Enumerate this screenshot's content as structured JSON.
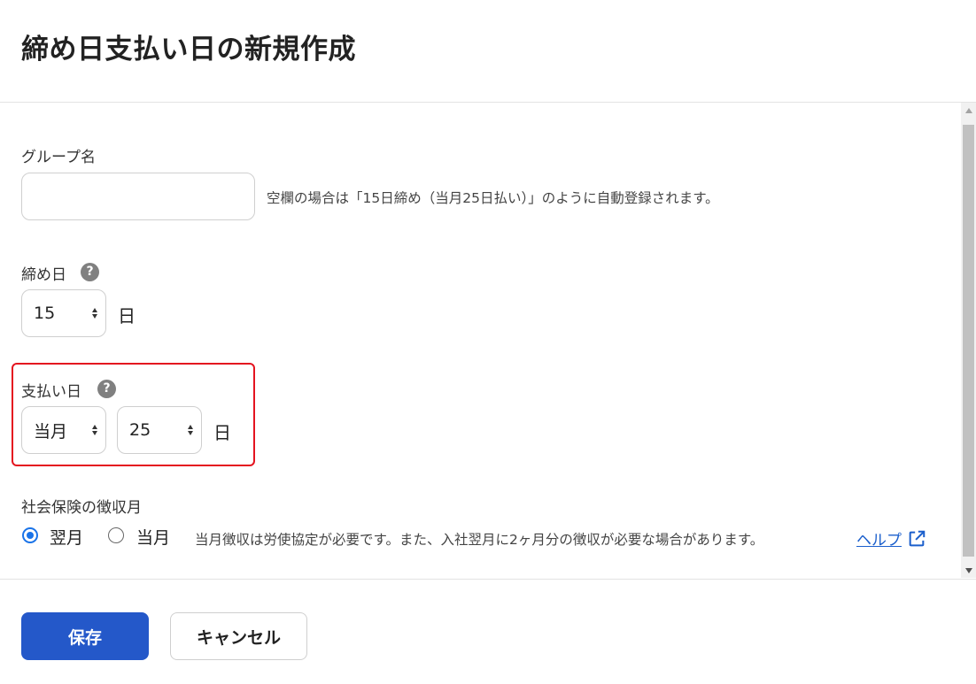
{
  "dialog": {
    "title": "締め日支払い日の新規作成"
  },
  "group_name": {
    "label": "グループ名",
    "value": "",
    "placeholder": "",
    "hint": "空欄の場合は「15日締め（当月25日払い）」のように自動登録されます。"
  },
  "closing_day": {
    "label": "締め日",
    "help_icon": "?",
    "day_value": "15",
    "unit": "日"
  },
  "payment_day": {
    "label": "支払い日",
    "help_icon": "?",
    "month_value": "当月",
    "day_value": "25",
    "unit": "日"
  },
  "social_insurance": {
    "label": "社会保険の徴収月",
    "options": [
      {
        "label": "翌月",
        "selected": true
      },
      {
        "label": "当月",
        "selected": false
      }
    ],
    "note": "当月徴収は労使協定が必要です。また、入社翌月に2ヶ月分の徴収が必要な場合があります。",
    "help_link": "ヘルプ"
  },
  "footer": {
    "save_label": "保存",
    "cancel_label": "キャンセル"
  },
  "colors": {
    "primary": "#2458c9",
    "highlight_border": "#e4141f",
    "link": "#1b5fcc",
    "radio_selected": "#1a73e8"
  }
}
